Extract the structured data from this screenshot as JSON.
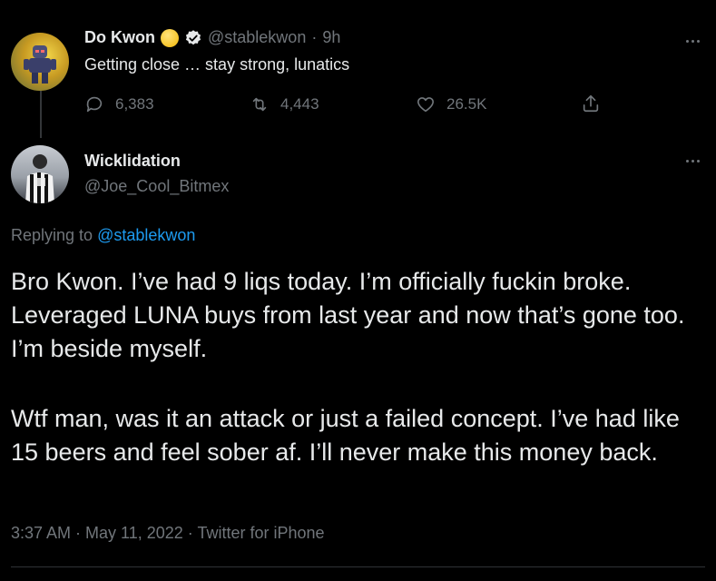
{
  "tweet": {
    "name": "Do Kwon",
    "handle": "@stablekwon",
    "separator": "·",
    "time": "9h",
    "text": "Getting close … stay strong, lunatics",
    "stats": {
      "replies": "6,383",
      "retweets": "4,443",
      "likes": "26.5K"
    }
  },
  "reply": {
    "name": "Wicklidation",
    "handle": "@Joe_Cool_Bitmex",
    "replying_prefix": "Replying to",
    "replying_to": "@stablekwon",
    "paragraph1": "Bro Kwon. I’ve had 9 liqs today. I’m officially fuckin broke. Leveraged LUNA buys from last year and now that’s gone too. I’m beside myself.",
    "paragraph2": "Wtf man, was it an attack or just a failed concept. I’ve had like 15 beers and feel sober af. I’ll never make this money back.",
    "timestamp": "3:37 AM · May 11, 2022 · Twitter for iPhone"
  },
  "colors": {
    "background": "#000000",
    "text": "#e7e9ea",
    "muted": "#71767b",
    "link": "#1d9bf0",
    "verified": "#e7e9ea"
  },
  "icons": [
    "reply-icon",
    "retweet-icon",
    "like-icon",
    "share-icon",
    "more-icon",
    "verified-icon",
    "coin-emoji-icon"
  ]
}
